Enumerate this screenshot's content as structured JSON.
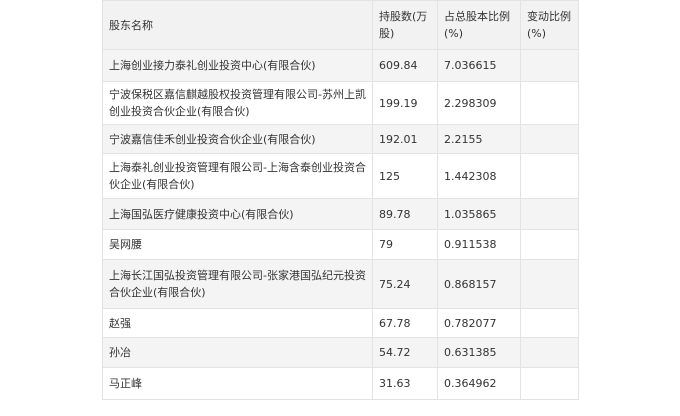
{
  "table": {
    "headers": [
      "股东名称",
      "持股数(万股)",
      "占总股本比例(%)",
      "变动比例(%)"
    ],
    "rows": [
      [
        "上海创业接力泰礼创业投资中心(有限合伙)",
        "609.84",
        "7.036615",
        ""
      ],
      [
        "宁波保税区嘉信麒越股权投资管理有限公司-苏州上凯创业投资合伙企业(有限合伙)",
        "199.19",
        "2.298309",
        ""
      ],
      [
        "宁波嘉信佳禾创业投资合伙企业(有限合伙)",
        "192.01",
        "2.2155",
        ""
      ],
      [
        "上海泰礼创业投资管理有限公司-上海含泰创业投资合伙企业(有限合伙)",
        "125",
        "1.442308",
        ""
      ],
      [
        "上海国弘医疗健康投资中心(有限合伙)",
        "89.78",
        "1.035865",
        ""
      ],
      [
        "吴网腰",
        "79",
        "0.911538",
        ""
      ],
      [
        "上海长江国弘投资管理有限公司-张家港国弘纪元投资合伙企业(有限合伙)",
        "75.24",
        "0.868157",
        ""
      ],
      [
        "赵强",
        "67.78",
        "0.782077",
        ""
      ],
      [
        "孙冶",
        "54.72",
        "0.631385",
        ""
      ],
      [
        "马正峰",
        "31.63",
        "0.364962",
        ""
      ]
    ]
  }
}
